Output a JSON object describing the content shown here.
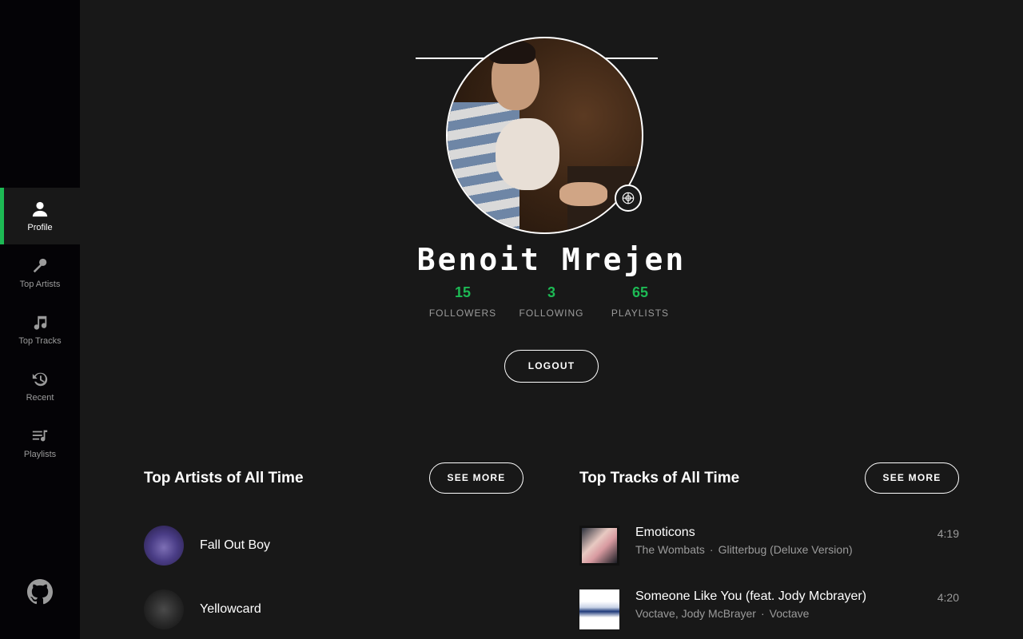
{
  "sidebar": {
    "items": [
      {
        "label": "Profile",
        "icon": "user-icon",
        "active": true
      },
      {
        "label": "Top Artists",
        "icon": "microphone-icon"
      },
      {
        "label": "Top Tracks",
        "icon": "music-note-icon"
      },
      {
        "label": "Recent",
        "icon": "history-icon"
      },
      {
        "label": "Playlists",
        "icon": "playlist-icon"
      }
    ],
    "footer_icon": "github-icon"
  },
  "profile": {
    "name": "Benoit Mrejen",
    "stats": [
      {
        "value": "15",
        "label": "FOLLOWERS"
      },
      {
        "value": "3",
        "label": "FOLLOWING"
      },
      {
        "value": "65",
        "label": "PLAYLISTS"
      }
    ],
    "logout_label": "LOGOUT"
  },
  "top_artists": {
    "title": "Top Artists of All Time",
    "see_more": "SEE MORE",
    "items": [
      {
        "name": "Fall Out Boy"
      },
      {
        "name": "Yellowcard"
      }
    ]
  },
  "top_tracks": {
    "title": "Top Tracks of All Time",
    "see_more": "SEE MORE",
    "items": [
      {
        "title": "Emoticons",
        "artists": "The Wombats",
        "album": "Glitterbug (Deluxe Version)",
        "duration": "4:19"
      },
      {
        "title": "Someone Like You (feat. Jody Mcbrayer)",
        "artists": "Voctave, Jody McBrayer",
        "album": "Voctave",
        "duration": "4:20"
      }
    ]
  },
  "colors": {
    "accent": "#1db954",
    "background": "#181818",
    "sidebar": "#040306",
    "muted_text": "#9b9b9b"
  }
}
